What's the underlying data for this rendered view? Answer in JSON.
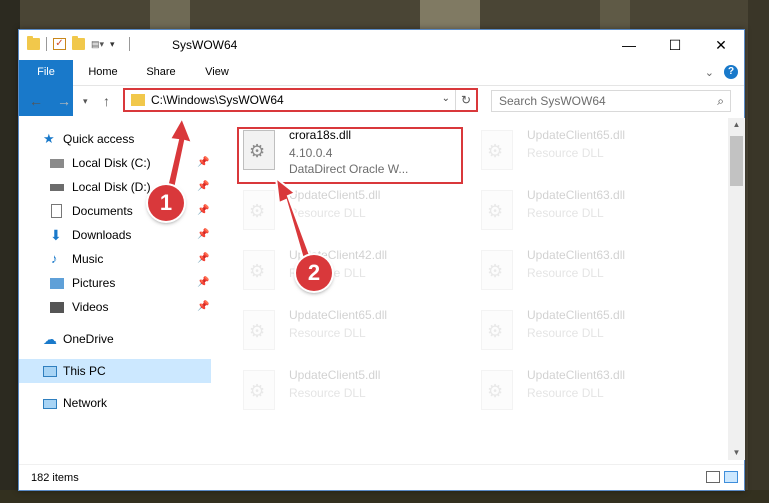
{
  "window": {
    "title": "SysWOW64"
  },
  "titlebar": {
    "minimize": "—",
    "maximize": "☐",
    "close": "✕"
  },
  "ribbon": {
    "tabs": [
      "File",
      "Home",
      "Share",
      "View"
    ],
    "help": "?"
  },
  "address": {
    "path": "C:\\Windows\\SysWOW64"
  },
  "search": {
    "placeholder": "Search SysWOW64"
  },
  "sidebar": {
    "items": [
      {
        "label": "Quick access"
      },
      {
        "label": "Local Disk (C:)"
      },
      {
        "label": "Local Disk (D:)"
      },
      {
        "label": "Documents"
      },
      {
        "label": "Downloads"
      },
      {
        "label": "Music"
      },
      {
        "label": "Pictures"
      },
      {
        "label": "Videos"
      },
      {
        "label": "OneDrive"
      },
      {
        "label": "This PC"
      },
      {
        "label": "Network"
      }
    ]
  },
  "files": [
    {
      "name": "crora18s.dll",
      "line1": "4.10.0.4",
      "line2": "DataDirect Oracle W..."
    },
    {
      "name": "UpdateClient65.dll",
      "line1": "Resource DLL"
    },
    {
      "name": "UpdateClient5.dll",
      "line1": "Resource DLL"
    },
    {
      "name": "UpdateClient63.dll",
      "line1": "Resource DLL"
    },
    {
      "name": "UpdateClient42.dll",
      "line1": "Resource DLL"
    },
    {
      "name": "UpdateClient63.dll",
      "line1": "Resource DLL"
    },
    {
      "name": "UpdateClient65.dll",
      "line1": "Resource DLL"
    },
    {
      "name": "UpdateClient65.dll",
      "line1": "Resource DLL"
    },
    {
      "name": "UpdateClient5.dll",
      "line1": "Resource DLL"
    },
    {
      "name": "UpdateClient63.dll",
      "line1": "Resource DLL"
    }
  ],
  "status": {
    "items": "182 items"
  },
  "callouts": [
    "1",
    "2"
  ],
  "colors": {
    "accent": "#1979ca",
    "highlight": "#d9383b",
    "selection": "#cce8ff"
  }
}
